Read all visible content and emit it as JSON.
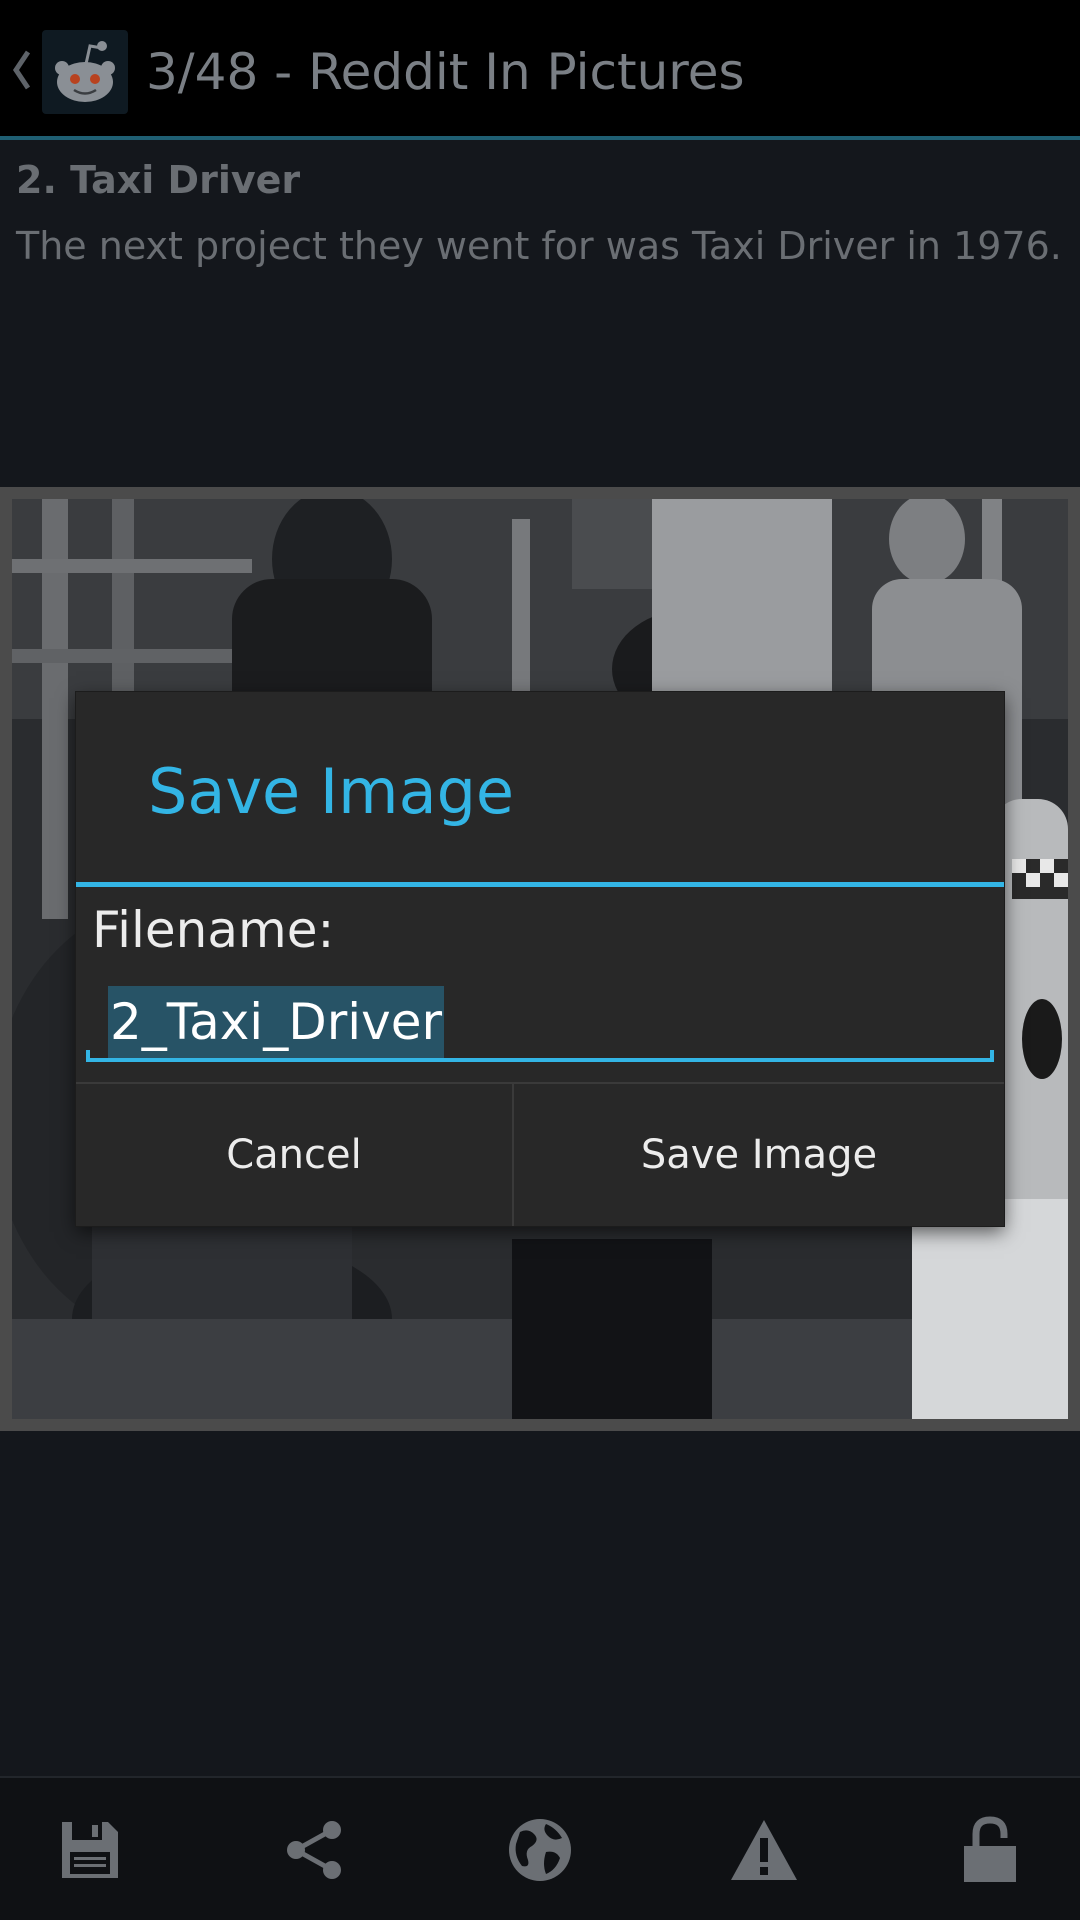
{
  "actionbar": {
    "title": "3/48 - Reddit In Pictures",
    "up_icon": "chevron-left-icon",
    "app_icon": "reddit-alien-icon"
  },
  "post": {
    "header": "2. Taxi Driver",
    "body": "The next project they went for was Taxi Driver in 1976."
  },
  "dialog": {
    "title": "Save Image",
    "field_label": "Filename:",
    "field_value": "2_Taxi_Driver",
    "cancel_label": "Cancel",
    "confirm_label": "Save Image"
  },
  "bottombar": {
    "items": [
      {
        "icon": "save-icon"
      },
      {
        "icon": "share-icon"
      },
      {
        "icon": "globe-icon"
      },
      {
        "icon": "warning-icon"
      },
      {
        "icon": "lock-icon"
      }
    ]
  },
  "colors": {
    "accent": "#33b5e5",
    "dialog_bg": "#282828",
    "actionbar_bg": "#000000",
    "selection": "#275366"
  }
}
